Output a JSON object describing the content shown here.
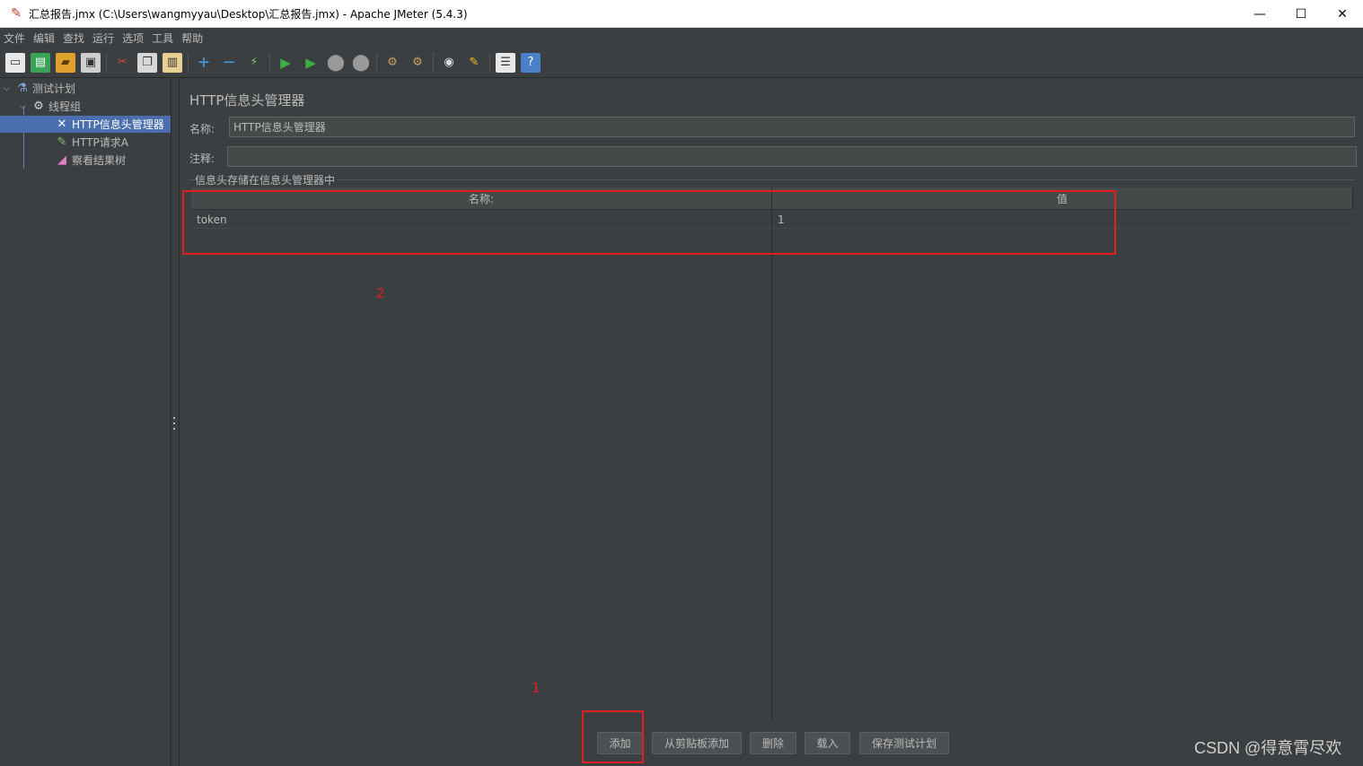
{
  "window": {
    "title": "汇总报告.jmx (C:\\Users\\wangmyyau\\Desktop\\汇总报告.jmx) - Apache JMeter (5.4.3)"
  },
  "menu": [
    "文件",
    "编辑",
    "查找",
    "运行",
    "选项",
    "工具",
    "帮助"
  ],
  "tree": {
    "items": [
      {
        "label": "测试计划",
        "icon": "flask-icon"
      },
      {
        "label": "线程组",
        "icon": "gear-icon"
      },
      {
        "label": "HTTP信息头管理器",
        "icon": "wrench-icon",
        "selected": true
      },
      {
        "label": "HTTP请求A",
        "icon": "pencil-icon"
      },
      {
        "label": "察看结果树",
        "icon": "chart-icon"
      }
    ]
  },
  "panel": {
    "title": "HTTP信息头管理器",
    "name_label": "名称:",
    "name_value": "HTTP信息头管理器",
    "comment_label": "注释:",
    "comment_value": "",
    "group_title": "信息头存储在信息头管理器中"
  },
  "table": {
    "headers": [
      "名称:",
      "值"
    ],
    "rows": [
      {
        "name": "token",
        "value": "1"
      }
    ]
  },
  "buttons": {
    "add": "添加",
    "add_from_clipboard": "从剪贴板添加",
    "delete": "删除",
    "load": "载入",
    "save_plan": "保存测试计划"
  },
  "annotations": {
    "label_1": "1",
    "label_2": "2",
    "color": "#e02020"
  },
  "watermark": "CSDN @得意霄尽欢"
}
